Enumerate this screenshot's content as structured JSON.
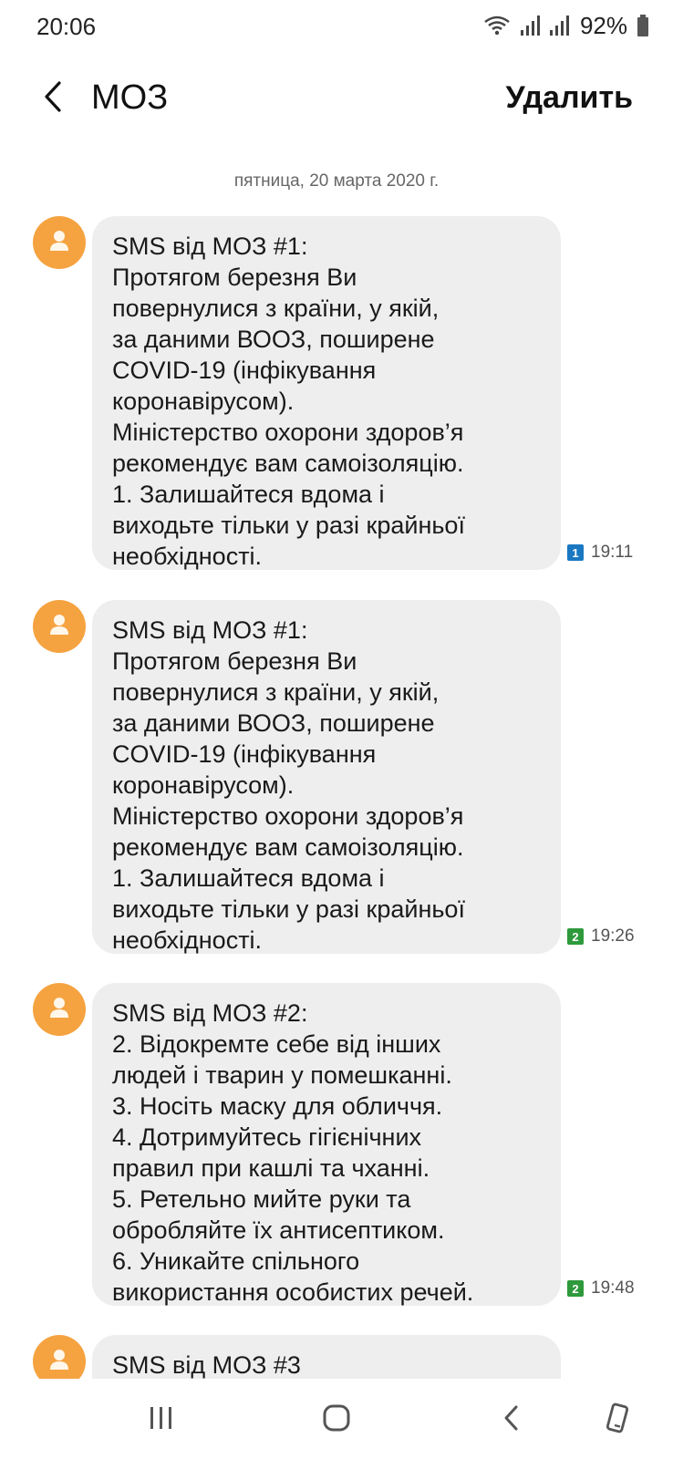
{
  "status_bar": {
    "time": "20:06",
    "battery": "92%",
    "icons": [
      "wifi-icon",
      "signal-icon",
      "signal-icon",
      "battery-icon"
    ]
  },
  "header": {
    "back_icon": "back-arrow-icon",
    "title": "МОЗ",
    "delete_label": "Удалить"
  },
  "thread": {
    "date": "пятница, 20 марта 2020 г.",
    "messages": [
      {
        "text": "SMS від МОЗ #1:\nПротягом березня Ви\nповернулися з країни, у якій,\nза даними ВООЗ, поширене\nCOVID-19 (інфікування\nкоронавірусом).\nМіністерство охорони здоров’я\nрекомендує вам самоізоляцію.\n1. Залишайтеся вдома і\nвиходьте тільки у разі крайньої\nнеобхідності.",
        "sim": "1",
        "sim_color": "#1a78c2",
        "time": "19:11"
      },
      {
        "text": "SMS від МОЗ #1:\nПротягом березня Ви\nповернулися з країни, у якій,\nза даними ВООЗ, поширене\nCOVID-19 (інфікування\nкоронавірусом).\nМіністерство охорони здоров’я\nрекомендує вам самоізоляцію.\n1. Залишайтеся вдома і\nвиходьте тільки у разі крайньої\nнеобхідності.",
        "sim": "2",
        "sim_color": "#2e9a3c",
        "time": "19:26"
      },
      {
        "text": "SMS від МОЗ #2:\n2. Відокремте себе від інших\nлюдей і тварин у помешканні.\n3. Носіть маску для обличчя.\n4. Дотримуйтесь гігієнічних\nправил при кашлі та чханні.\n5. Ретельно мийте руки та\nобробляйте їх антисептиком.\n6. Уникайте спільного\nвикористання особистих речей.",
        "sim": "2",
        "sim_color": "#2e9a3c",
        "time": "19:48"
      },
      {
        "text": "SMS від МОЗ #3"
      }
    ]
  },
  "nav_bar": {
    "icons": [
      "recent-apps-icon",
      "home-icon",
      "back-icon",
      "rotate-icon"
    ]
  },
  "colors": {
    "avatar": "#f5a340",
    "bubble": "#eeeeee",
    "sim1": "#1a78c2",
    "sim2": "#2e9a3c"
  }
}
